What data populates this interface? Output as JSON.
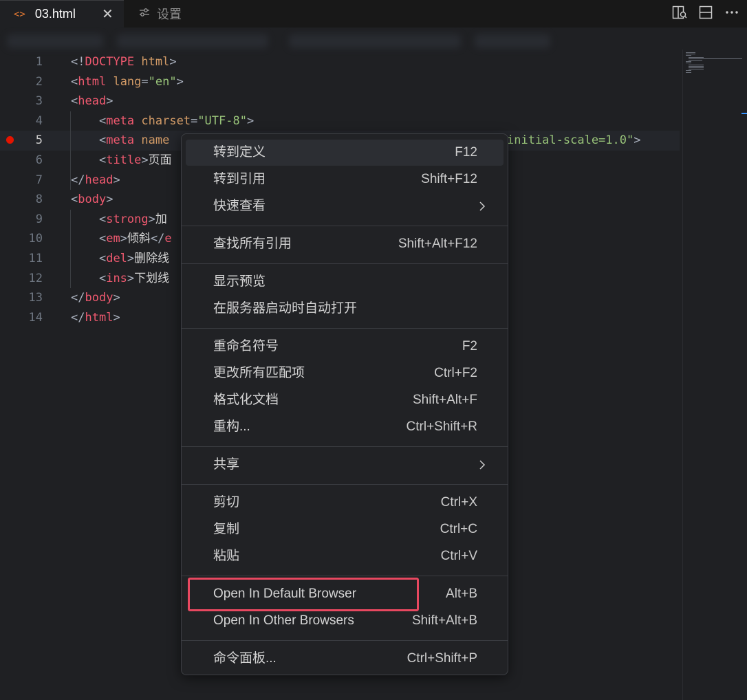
{
  "tabs": [
    {
      "label": "03.html",
      "icon": "html-file-icon",
      "active": true,
      "close": "✕"
    },
    {
      "label": "设置",
      "icon": "settings-sliders-icon",
      "active": false
    }
  ],
  "editor": {
    "current_line": 5,
    "lines": [
      {
        "n": "1",
        "tokens": [
          [
            "br",
            "<!"
          ],
          [
            "tag",
            "DOCTYPE"
          ],
          [
            "txt",
            " "
          ],
          [
            "attr",
            "html"
          ],
          [
            "br",
            ">"
          ]
        ]
      },
      {
        "n": "2",
        "tokens": [
          [
            "br",
            "<"
          ],
          [
            "tag",
            "html"
          ],
          [
            "txt",
            " "
          ],
          [
            "attr",
            "lang"
          ],
          [
            "br",
            "="
          ],
          [
            "str",
            "\"en\""
          ],
          [
            "br",
            ">"
          ]
        ]
      },
      {
        "n": "3",
        "tokens": [
          [
            "br",
            "<"
          ],
          [
            "tag",
            "head"
          ],
          [
            "br",
            ">"
          ]
        ]
      },
      {
        "n": "4",
        "tokens": [
          [
            "txt",
            "    "
          ],
          [
            "br",
            "<"
          ],
          [
            "tag",
            "meta"
          ],
          [
            "txt",
            " "
          ],
          [
            "attr",
            "charset"
          ],
          [
            "br",
            "="
          ],
          [
            "str",
            "\"UTF-8\""
          ],
          [
            "br",
            ">"
          ]
        ]
      },
      {
        "n": "5",
        "tokens": [
          [
            "txt",
            "    "
          ],
          [
            "br",
            "<"
          ],
          [
            "tag",
            "meta"
          ],
          [
            "txt",
            " "
          ],
          [
            "attr",
            "name"
          ]
        ],
        "tail": [
          [
            "str",
            "initial-scale=1.0\""
          ],
          [
            "br",
            ">"
          ]
        ]
      },
      {
        "n": "6",
        "tokens": [
          [
            "txt",
            "    "
          ],
          [
            "br",
            "<"
          ],
          [
            "tag",
            "title"
          ],
          [
            "br",
            ">"
          ],
          [
            "txt",
            "页面"
          ]
        ]
      },
      {
        "n": "7",
        "tokens": [
          [
            "br",
            "</"
          ],
          [
            "tag",
            "head"
          ],
          [
            "br",
            ">"
          ]
        ]
      },
      {
        "n": "8",
        "tokens": [
          [
            "br",
            "<"
          ],
          [
            "tag",
            "body"
          ],
          [
            "br",
            ">"
          ]
        ]
      },
      {
        "n": "9",
        "tokens": [
          [
            "txt",
            "    "
          ],
          [
            "br",
            "<"
          ],
          [
            "tag",
            "strong"
          ],
          [
            "br",
            ">"
          ],
          [
            "txt",
            "加"
          ]
        ]
      },
      {
        "n": "10",
        "tokens": [
          [
            "txt",
            "    "
          ],
          [
            "br",
            "<"
          ],
          [
            "tag",
            "em"
          ],
          [
            "br",
            ">"
          ],
          [
            "txt",
            "倾斜"
          ],
          [
            "br",
            "</"
          ],
          [
            "tag",
            "e"
          ]
        ]
      },
      {
        "n": "11",
        "tokens": [
          [
            "txt",
            "    "
          ],
          [
            "br",
            "<"
          ],
          [
            "tag",
            "del"
          ],
          [
            "br",
            ">"
          ],
          [
            "txt",
            "删除线"
          ]
        ]
      },
      {
        "n": "12",
        "tokens": [
          [
            "txt",
            "    "
          ],
          [
            "br",
            "<"
          ],
          [
            "tag",
            "ins"
          ],
          [
            "br",
            ">"
          ],
          [
            "txt",
            "下划线"
          ]
        ]
      },
      {
        "n": "13",
        "tokens": [
          [
            "br",
            "</"
          ],
          [
            "tag",
            "body"
          ],
          [
            "br",
            ">"
          ]
        ]
      },
      {
        "n": "14",
        "tokens": [
          [
            "br",
            "</"
          ],
          [
            "tag",
            "html"
          ],
          [
            "br",
            ">"
          ]
        ]
      }
    ]
  },
  "context_menu": {
    "items": [
      {
        "label": "转到定义",
        "key": "F12",
        "highlighted": true
      },
      {
        "label": "转到引用",
        "key": "Shift+F12"
      },
      {
        "label": "快速查看",
        "key": "",
        "submenu": true
      },
      {
        "sep": true
      },
      {
        "label": "查找所有引用",
        "key": "Shift+Alt+F12"
      },
      {
        "sep": true
      },
      {
        "label": "显示预览",
        "key": ""
      },
      {
        "label": "在服务器启动时自动打开",
        "key": ""
      },
      {
        "sep": true
      },
      {
        "label": "重命名符号",
        "key": "F2"
      },
      {
        "label": "更改所有匹配项",
        "key": "Ctrl+F2"
      },
      {
        "label": "格式化文档",
        "key": "Shift+Alt+F"
      },
      {
        "label": "重构...",
        "key": "Ctrl+Shift+R"
      },
      {
        "sep": true
      },
      {
        "label": "共享",
        "key": "",
        "submenu": true
      },
      {
        "sep": true
      },
      {
        "label": "剪切",
        "key": "Ctrl+X"
      },
      {
        "label": "复制",
        "key": "Ctrl+C"
      },
      {
        "label": "粘贴",
        "key": "Ctrl+V"
      },
      {
        "sep": true
      },
      {
        "label": "Open In Default Browser",
        "key": "Alt+B",
        "annotated": true
      },
      {
        "label": "Open In Other Browsers",
        "key": "Shift+Alt+B"
      },
      {
        "sep": true
      },
      {
        "label": "命令面板...",
        "key": "Ctrl+Shift+P"
      }
    ]
  },
  "toolbar_icons": [
    "split-editor-icon",
    "toggle-panel-icon",
    "more-actions-icon"
  ],
  "colors": {
    "annotation": "#e84860",
    "accent": "#3794ff",
    "breakpoint": "#e51400"
  }
}
